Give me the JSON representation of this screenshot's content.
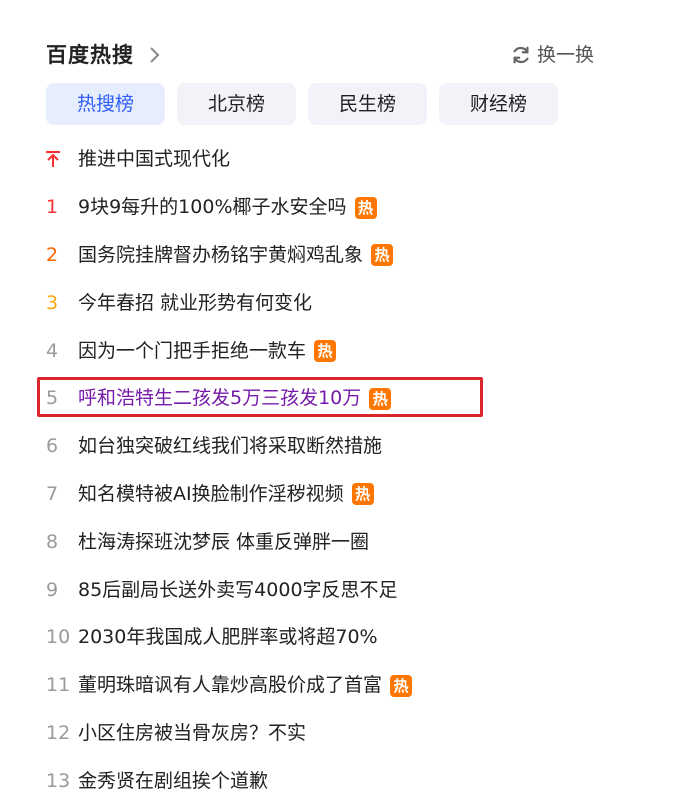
{
  "header": {
    "title": "百度热搜",
    "refresh_label": "换一换"
  },
  "tabs": [
    {
      "label": "热搜榜",
      "active": true
    },
    {
      "label": "北京榜",
      "active": false
    },
    {
      "label": "民生榜",
      "active": false
    },
    {
      "label": "财经榜",
      "active": false
    }
  ],
  "items": [
    {
      "rank": "",
      "pinned": true,
      "text": "推进中国式现代化",
      "hot": false
    },
    {
      "rank": "1",
      "text": "9块9每升的100%椰子水安全吗",
      "hot": true
    },
    {
      "rank": "2",
      "text": "国务院挂牌督办杨铭宇黄焖鸡乱象",
      "hot": true
    },
    {
      "rank": "3",
      "text": "今年春招 就业形势有何变化",
      "hot": false
    },
    {
      "rank": "4",
      "text": "因为一个门把手拒绝一款车",
      "hot": true
    },
    {
      "rank": "5",
      "text": "呼和浩特生二孩发5万三孩发10万",
      "hot": true,
      "visited": true,
      "highlighted": true
    },
    {
      "rank": "6",
      "text": "如台独突破红线我们将采取断然措施",
      "hot": false
    },
    {
      "rank": "7",
      "text": "知名模特被AI换脸制作淫秽视频",
      "hot": true
    },
    {
      "rank": "8",
      "text": "杜海涛探班沈梦辰 体重反弹胖一圈",
      "hot": false
    },
    {
      "rank": "9",
      "text": "85后副局长送外卖写4000字反思不足",
      "hot": false
    },
    {
      "rank": "10",
      "text": "2030年我国成人肥胖率或将超70%",
      "hot": false
    },
    {
      "rank": "11",
      "text": "董明珠暗讽有人靠炒高股价成了首富",
      "hot": true
    },
    {
      "rank": "12",
      "text": "小区住房被当骨灰房？不实",
      "hot": false
    },
    {
      "rank": "13",
      "text": "金秀贤在剧组挨个道歉",
      "hot": false
    }
  ],
  "badge": {
    "hot_label": "热"
  },
  "colors": {
    "accent": "#315efb",
    "rank1": "#f73131",
    "rank2": "#ff6600",
    "rank3": "#faa90e",
    "hot_badge": "#ff7600",
    "visited": "#771caa",
    "highlight_box": "#d9262b"
  }
}
